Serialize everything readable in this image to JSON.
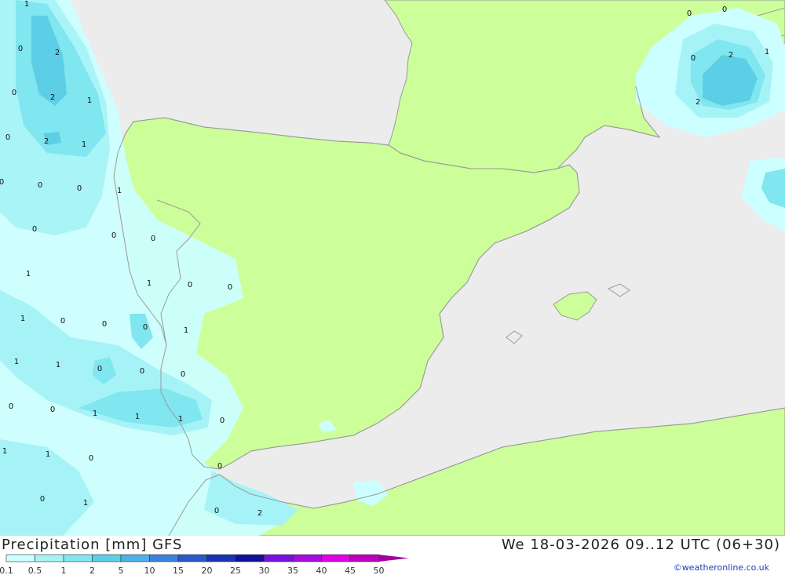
{
  "title_left": "Precipitation [mm] GFS",
  "title_right": "We 18-03-2026 09..12 UTC (06+30)",
  "credit": "©weatheronline.co.uk",
  "colors": {
    "sea": "#ececec",
    "land": "#ccff99",
    "coast": "#9a9a9a",
    "precip_01": "#ccffff",
    "precip_05": "#a6f3f7",
    "precip_1": "#80e6ef",
    "precip_2": "#5ccfe6"
  },
  "legend": {
    "labels": [
      "0.1",
      "0.5",
      "1",
      "2",
      "5",
      "10",
      "15",
      "20",
      "25",
      "30",
      "35",
      "40",
      "45",
      "50"
    ],
    "colors": [
      "#ccffff",
      "#a6f3f7",
      "#80e6ef",
      "#5ccfe6",
      "#4eb0e6",
      "#3c82dc",
      "#2a58cc",
      "#1a32b4",
      "#10109a",
      "#7a10e0",
      "#a60ce0",
      "#e000e6",
      "#c000c0",
      "#a000a0"
    ]
  },
  "contour_labels": [
    "1",
    "2",
    "2",
    "1",
    "2",
    "1",
    "0",
    "0",
    "0",
    "0",
    "0",
    "0",
    "1",
    "0",
    "0",
    "0",
    "1",
    "0",
    "0",
    "1",
    "0",
    "1",
    "0",
    "0",
    "1",
    "1",
    "0",
    "0",
    "0",
    "1",
    "1",
    "1",
    "0",
    "0",
    "1",
    "1",
    "0",
    "1",
    "0",
    "0",
    "0",
    "1",
    "0",
    "2",
    "0",
    "0",
    "2",
    "2",
    "0",
    "1"
  ]
}
